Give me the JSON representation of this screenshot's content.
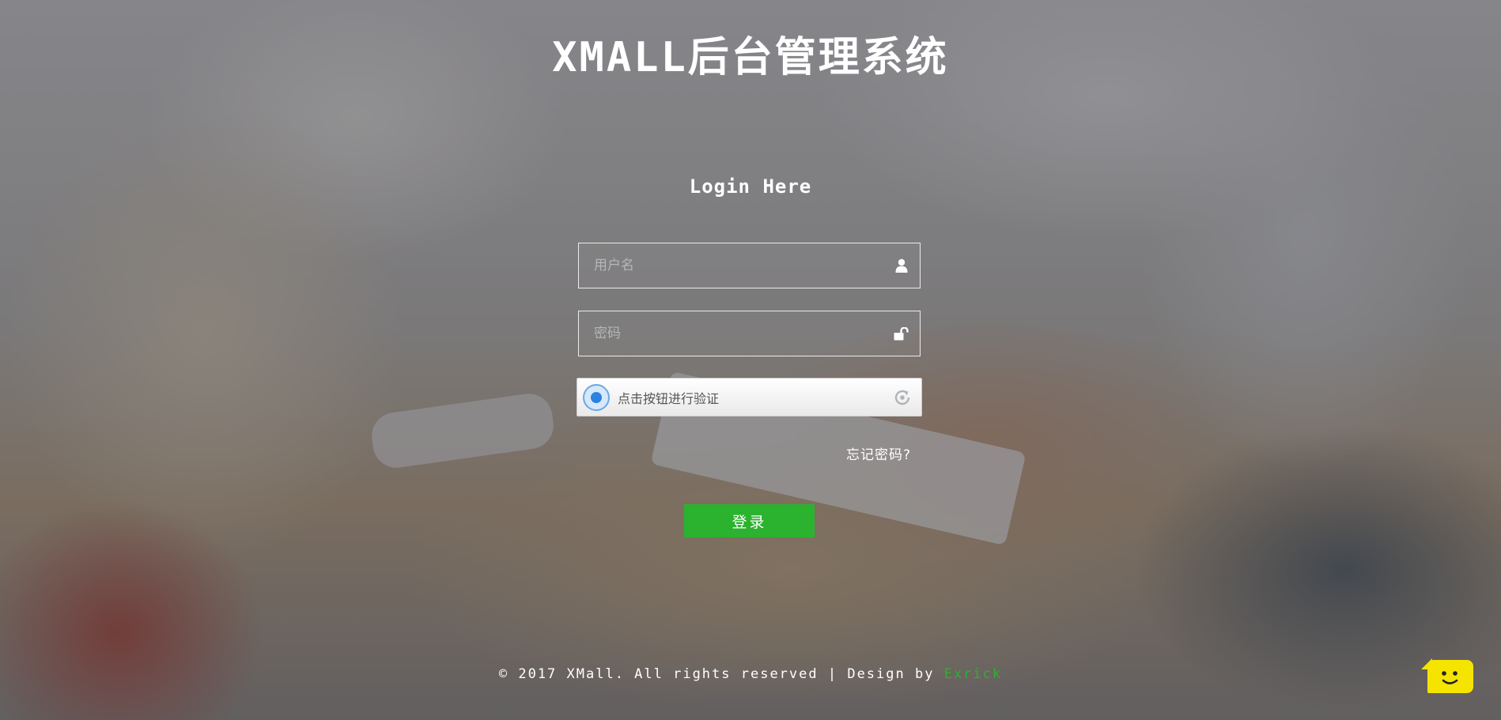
{
  "page": {
    "title": "XMALL后台管理系统",
    "subtitle": "Login Here"
  },
  "form": {
    "username_placeholder": "用户名",
    "username_value": "",
    "password_placeholder": "密码",
    "password_value": "",
    "captcha_text": "点击按钮进行验证",
    "forgot_label": "忘记密码?",
    "login_label": "登录"
  },
  "footer": {
    "copyright": "© 2017 XMall. All rights reserved | Design by",
    "author": "Exrick"
  },
  "icons": {
    "username": "user-icon",
    "password": "unlock-icon",
    "captcha": "radio-target-icon",
    "refresh": "refresh-icon",
    "chat": "chat-bot-icon"
  },
  "colors": {
    "accent": "#2bb22f",
    "chat_widget": "#f5e400",
    "captcha_blue": "#2b82e0"
  }
}
